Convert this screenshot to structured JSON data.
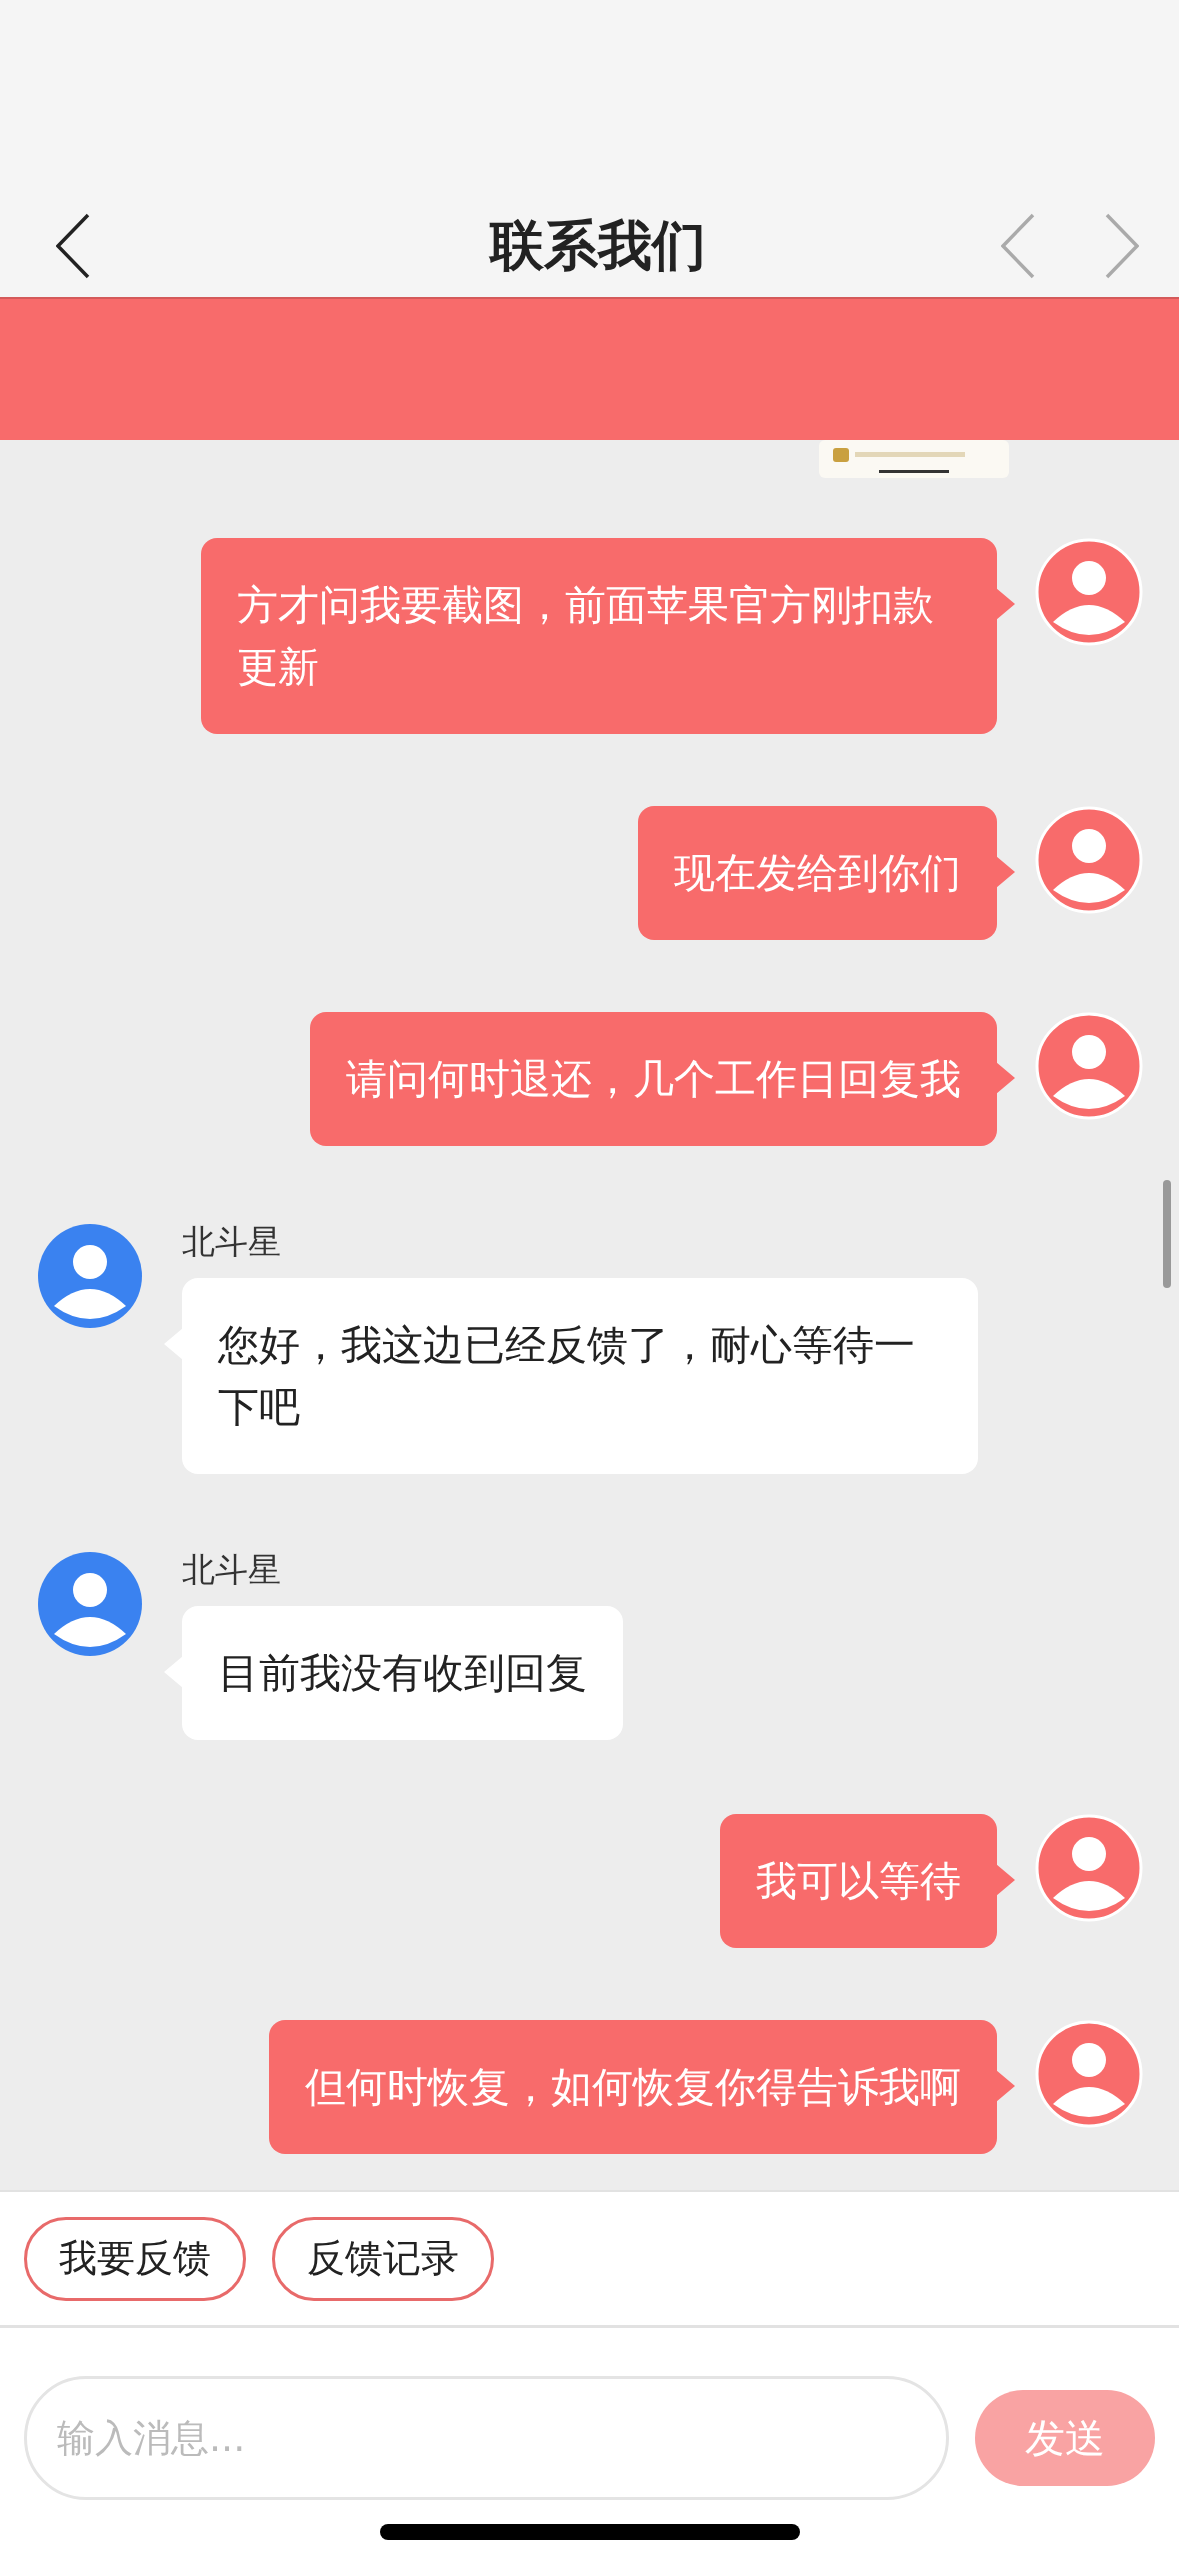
{
  "header": {
    "title": "联系我们"
  },
  "banner": {
    "kind": "notice"
  },
  "messages": [
    {
      "outgoing": true,
      "kind": "picture"
    },
    {
      "outgoing": true,
      "kind": "text",
      "text": "方才问我要截图，前面苹果官方刚扣款更新"
    },
    {
      "outgoing": true,
      "kind": "text",
      "text": "现在发给到你们"
    },
    {
      "outgoing": true,
      "kind": "text",
      "text": "请问何时退还，几个工作日回复我"
    },
    {
      "outgoing": false,
      "kind": "text",
      "sender": "北斗星",
      "text": "您好，我这边已经反馈了，耐心等待一下吧"
    },
    {
      "outgoing": false,
      "kind": "text",
      "sender": "北斗星",
      "text": "目前我没有收到回复"
    },
    {
      "outgoing": true,
      "kind": "text",
      "text": "我可以等待"
    },
    {
      "outgoing": true,
      "kind": "text",
      "text": "但何时恢复，如何恢复你得告诉我啊"
    }
  ],
  "quick_actions": [
    "我要反馈",
    "反馈记录"
  ],
  "composer": {
    "placeholder": "输入消息...",
    "send": {
      "label": "发送",
      "disabled": true
    }
  }
}
